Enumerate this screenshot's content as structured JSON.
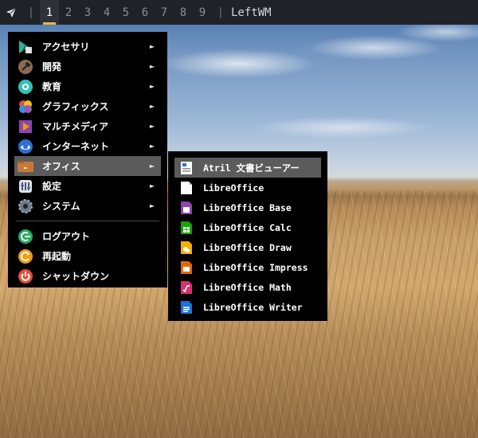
{
  "topbar": {
    "launcher_icon": "paper-plane-icon",
    "separator": "|",
    "workspaces": [
      "1",
      "2",
      "3",
      "4",
      "5",
      "6",
      "7",
      "8",
      "9"
    ],
    "active_workspace": "1",
    "wm_name": "LeftWM",
    "accent_color": "#e7b84a"
  },
  "main_menu": {
    "items": [
      {
        "label": "アクセサリ",
        "icon": "accessories-icon",
        "submenu": true
      },
      {
        "label": "開発",
        "icon": "hammer-icon",
        "submenu": true
      },
      {
        "label": "教育",
        "icon": "education-icon",
        "submenu": true
      },
      {
        "label": "グラフィックス",
        "icon": "graphics-icon",
        "submenu": true
      },
      {
        "label": "マルチメディア",
        "icon": "multimedia-icon",
        "submenu": true
      },
      {
        "label": "インターネット",
        "icon": "internet-icon",
        "submenu": true
      },
      {
        "label": "オフィス",
        "icon": "office-icon",
        "submenu": true,
        "selected": true
      },
      {
        "label": "設定",
        "icon": "settings-icon",
        "submenu": true
      },
      {
        "label": "システム",
        "icon": "system-gear-icon",
        "submenu": true
      }
    ],
    "actions": [
      {
        "label": "ログアウト",
        "icon": "logout-icon"
      },
      {
        "label": "再起動",
        "icon": "restart-icon"
      },
      {
        "label": "シャットダウン",
        "icon": "power-icon"
      }
    ],
    "arrow_glyph": "►"
  },
  "sub_menu": {
    "items": [
      {
        "label": "Atril 文書ビューアー",
        "icon": "document-viewer-icon",
        "selected": true
      },
      {
        "label": "LibreOffice",
        "icon": "libreoffice-icon"
      },
      {
        "label": "LibreOffice Base",
        "icon": "libreoffice-base-icon"
      },
      {
        "label": "LibreOffice Calc",
        "icon": "libreoffice-calc-icon"
      },
      {
        "label": "LibreOffice Draw",
        "icon": "libreoffice-draw-icon"
      },
      {
        "label": "LibreOffice Impress",
        "icon": "libreoffice-impress-icon"
      },
      {
        "label": "LibreOffice Math",
        "icon": "libreoffice-math-icon"
      },
      {
        "label": "LibreOffice Writer",
        "icon": "libreoffice-writer-icon"
      }
    ]
  }
}
